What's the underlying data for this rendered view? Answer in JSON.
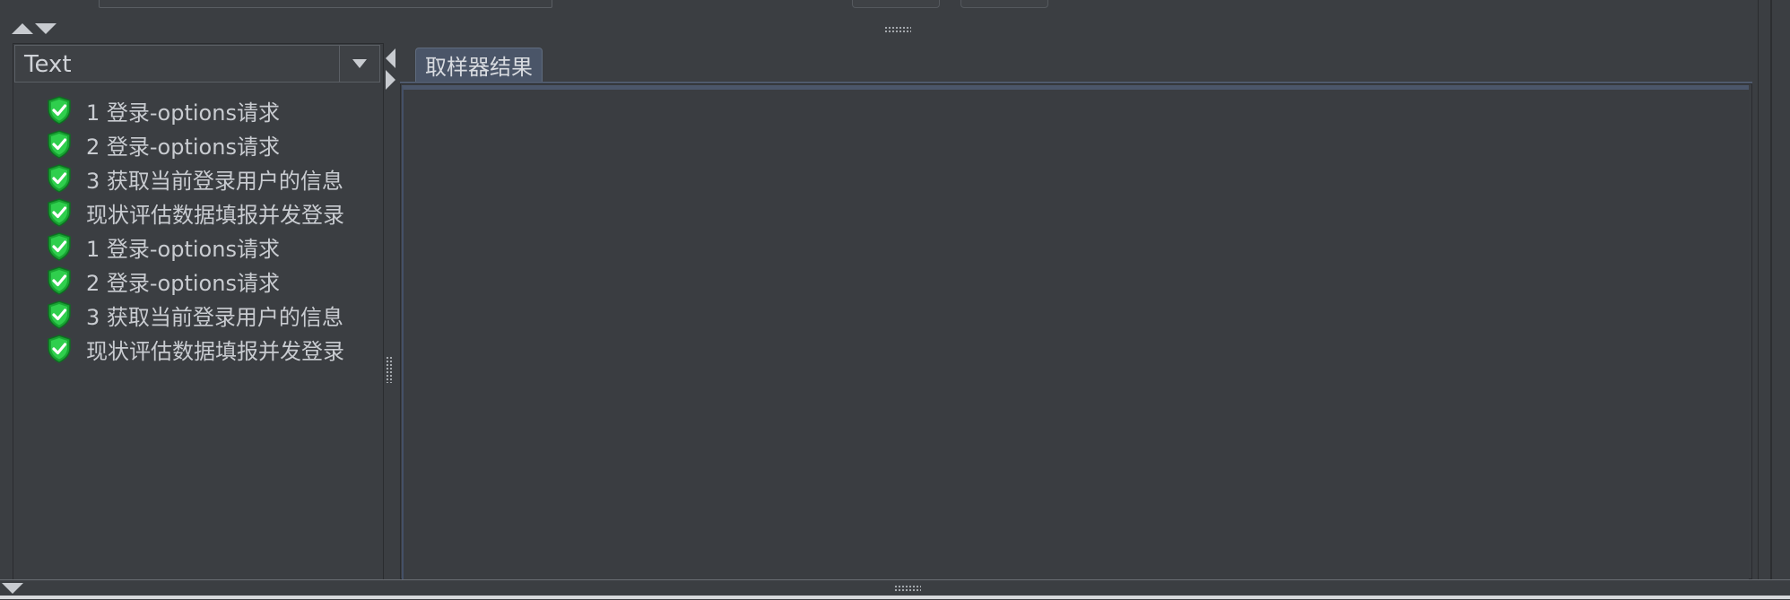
{
  "renderer_selector": {
    "selected": "Text"
  },
  "sampler_tree": {
    "items": [
      {
        "label": "1 登录-options请求",
        "status": "success"
      },
      {
        "label": "2 登录-options请求",
        "status": "success"
      },
      {
        "label": "3 获取当前登录用户的信息",
        "status": "success"
      },
      {
        "label": "现状评估数据填报并发登录",
        "status": "success"
      },
      {
        "label": "1 登录-options请求",
        "status": "success"
      },
      {
        "label": "2 登录-options请求",
        "status": "success"
      },
      {
        "label": "3 获取当前登录用户的信息",
        "status": "success"
      },
      {
        "label": "现状评估数据填报并发登录",
        "status": "success"
      }
    ]
  },
  "result_panel": {
    "tabs": [
      {
        "label": "取样器结果",
        "active": true
      }
    ]
  },
  "colors": {
    "background": "#3b3e42",
    "tab_active": "#4a5568",
    "success_icon": "#1fb53a"
  },
  "icons": {
    "success": "shield-check-icon",
    "collapse_up": "triangle-up-icon",
    "expand_down": "triangle-down-icon",
    "dropdown": "chevron-down-icon"
  }
}
